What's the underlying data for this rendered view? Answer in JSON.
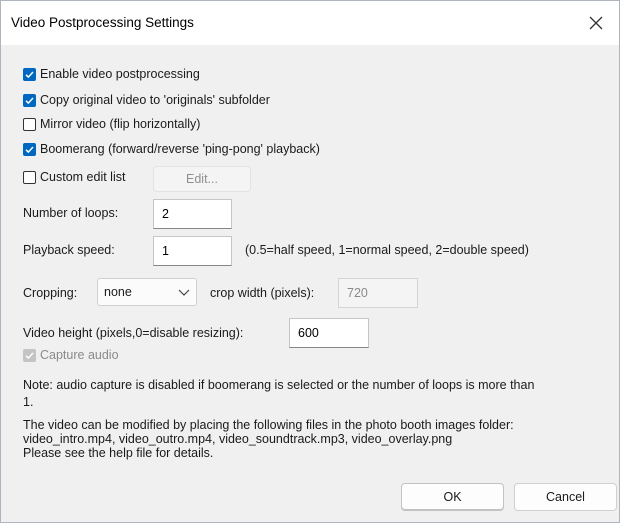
{
  "window": {
    "title": "Video Postprocessing Settings"
  },
  "icons": {
    "close": "close-icon",
    "checkmark": "checkmark-icon",
    "dropdown": "chevron-down-icon"
  },
  "colors": {
    "accent": "#0067c0",
    "dialog_bg": "#f0f0f0",
    "disabled_text": "#8a8a8a"
  },
  "options": {
    "enable_postprocessing": {
      "label": "Enable video postprocessing",
      "checked": true
    },
    "copy_original": {
      "label": "Copy original video to 'originals' subfolder",
      "checked": true
    },
    "mirror": {
      "label": "Mirror video (flip horizontally)",
      "checked": false
    },
    "boomerang": {
      "label": "Boomerang (forward/reverse 'ping-pong' playback)",
      "checked": true
    },
    "custom_edit_list": {
      "label": "Custom edit list",
      "checked": false,
      "edit_button": "Edit..."
    }
  },
  "loops": {
    "label": "Number of loops:",
    "value": "2"
  },
  "speed": {
    "label": "Playback speed:",
    "value": "1",
    "hint": "(0.5=half speed, 1=normal speed, 2=double speed)"
  },
  "cropping": {
    "label": "Cropping:",
    "selected": "none",
    "width_label": "crop width (pixels):",
    "width_value": "720"
  },
  "video_height": {
    "label": "Video height (pixels,0=disable resizing):",
    "value": "600"
  },
  "capture_audio": {
    "label": "Capture audio",
    "checked": true,
    "disabled": true
  },
  "notes": {
    "audio_note_line1": "Note: audio capture is disabled if boomerang is selected or the number of loops is more than",
    "audio_note_line2": "1.",
    "files_line1": "The video can be modified by placing the following files in the photo booth images folder:",
    "files_line2": "video_intro.mp4, video_outro.mp4, video_soundtrack.mp3, video_overlay.png",
    "files_line3": "Please see the help file for details."
  },
  "buttons": {
    "ok": "OK",
    "cancel": "Cancel"
  }
}
